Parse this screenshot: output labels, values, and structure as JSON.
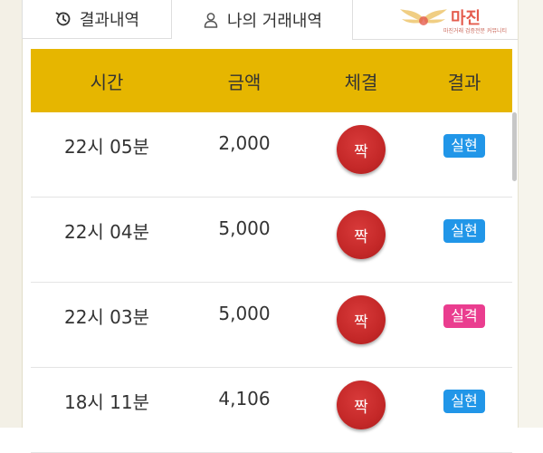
{
  "tabs": [
    {
      "label": "결과내역",
      "icon": "history-icon"
    },
    {
      "label": "나의 거래내역",
      "icon": "user-icon"
    }
  ],
  "watermark": {
    "text": "마진",
    "subtext": "마진거래 검증전문 커뮤니티"
  },
  "table": {
    "headers": [
      "시간",
      "금액",
      "체결",
      "결과"
    ],
    "rows": [
      {
        "time": "22시 05분",
        "amount": "2,000",
        "choice": "짝",
        "result": "실현",
        "result_color": "#2196e8"
      },
      {
        "time": "22시 04분",
        "amount": "5,000",
        "choice": "짝",
        "result": "실현",
        "result_color": "#2196e8"
      },
      {
        "time": "22시 03분",
        "amount": "5,000",
        "choice": "짝",
        "result": "실격",
        "result_color": "#ea3d8f"
      },
      {
        "time": "18시 11분",
        "amount": "4,106",
        "choice": "짝",
        "result": "실현",
        "result_color": "#2196e8"
      }
    ]
  },
  "colors": {
    "header_bg": "#e6b600",
    "circle_red": "#c42828",
    "badge_blue": "#2196e8",
    "badge_pink": "#ea3d8f"
  }
}
